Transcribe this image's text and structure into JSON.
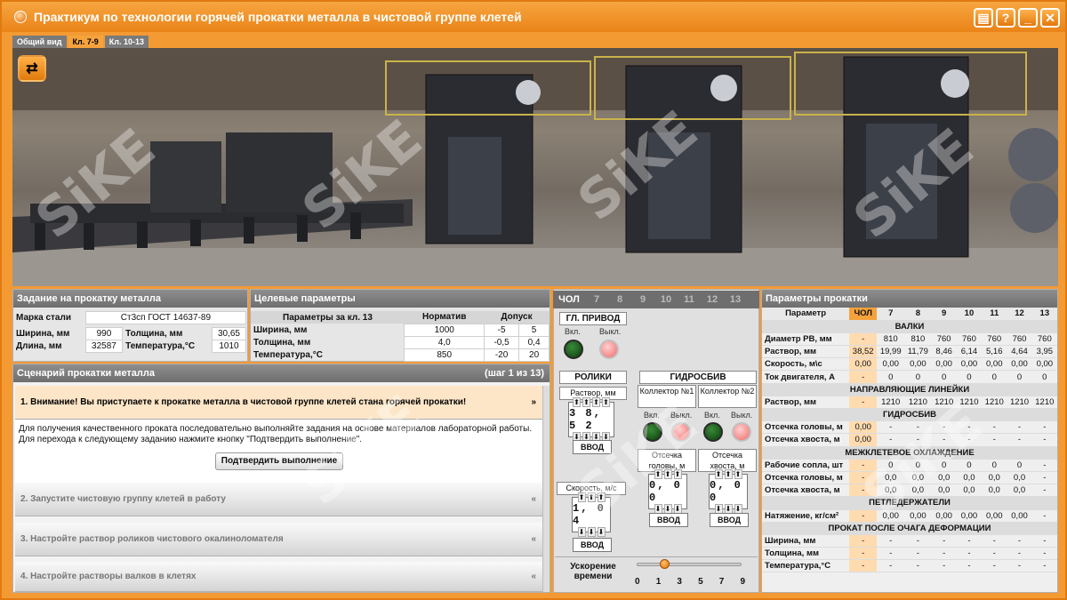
{
  "title": "Практикум по технологии горячей прокатки металла в чистовой группе клетей",
  "window_buttons": {
    "notes": "▤",
    "help": "?",
    "minimize": "_",
    "close": "✕"
  },
  "view_tabs": [
    "Общий вид",
    "Кл. 7-9",
    "Кл. 10-13"
  ],
  "active_view_tab": 1,
  "watermark": "SiKE",
  "task": {
    "header": "Задание на прокатку металла",
    "steel_label": "Марка стали",
    "steel_value": "Ст3сп ГОСТ 14637-89",
    "width_label": "Ширина, мм",
    "width_value": "990",
    "thickness_label": "Толщина, мм",
    "thickness_value": "30,65",
    "length_label": "Длина, мм",
    "length_value": "32587",
    "temp_label": "Температура,°С",
    "temp_value": "1010"
  },
  "targets": {
    "header": "Целевые параметры",
    "col_param": "Параметры за кл. 13",
    "col_norm": "Норматив",
    "col_tol": "Допуск",
    "rows": [
      {
        "name": "Ширина, мм",
        "norm": "1000",
        "tol_lo": "-5",
        "tol_hi": "5"
      },
      {
        "name": "Толщина, мм",
        "norm": "4,0",
        "tol_lo": "-0,5",
        "tol_hi": "0,4"
      },
      {
        "name": "Температура,°С",
        "norm": "850",
        "tol_lo": "-20",
        "tol_hi": "20"
      }
    ]
  },
  "scenario": {
    "header": "Сценарий прокатки металла",
    "step": "(шаг 1 из 13)",
    "items": [
      {
        "label": "1.  Внимание! Вы приступаете к прокатке металла в чистовой группе клетей стана горячей прокатки!",
        "chevron": "»"
      },
      {
        "label": "2.  Запустите чистовую группу клетей в работу",
        "chevron": "«"
      },
      {
        "label": "3.  Настройте раствор роликов чистового окалиноломателя",
        "chevron": "«"
      },
      {
        "label": "4.  Настройте растворы валков в клетях",
        "chevron": "«"
      }
    ],
    "body_lines": [
      "Для получения качественного проката последовательно выполняйте задания на основе материалов лабораторной работы.",
      "Для перехода к следующему заданию нажмите кнопку \"Подтвердить выполнение\"."
    ],
    "confirm_label": "Подтвердить выполнение"
  },
  "control": {
    "tabs": [
      "ЧОЛ",
      "7",
      "8",
      "9",
      "10",
      "11",
      "12",
      "13"
    ],
    "main_drive": "ГЛ. ПРИВОД",
    "on": "Вкл.",
    "off": "Выкл.",
    "rollers": "РОЛИКИ",
    "gap_label": "Раствор, мм",
    "gap_value": "3 8, 5 2",
    "speed_label": "Скорость, м/с",
    "speed_value": "1, 0 4",
    "enter": "ВВОД",
    "hydro": "ГИДРОСБИВ",
    "collector1": "Коллектор №1",
    "collector2": "Коллектор №2",
    "cut_head": "Отсечка головы, м",
    "cut_tail": "Отсечка хвоста, м",
    "cut_head_value": "0, 0 0",
    "cut_tail_value": "0, 0 0",
    "accel_label": "Ускорение времени",
    "accel_ticks": [
      "0",
      "1",
      "3",
      "5",
      "7",
      "9"
    ],
    "accel_value": 0.23
  },
  "params": {
    "header": "Параметры прокатки",
    "head": [
      "Параметр",
      "ЧОЛ",
      "7",
      "8",
      "9",
      "10",
      "11",
      "12",
      "13"
    ],
    "sections": [
      {
        "title": "ВАЛКИ",
        "rows": [
          {
            "name": "Диаметр РВ, мм",
            "v": [
              "-",
              "810",
              "810",
              "760",
              "760",
              "760",
              "760",
              "760"
            ]
          },
          {
            "name": "Раствор, мм",
            "v": [
              "38,52",
              "19,99",
              "11,79",
              "8,46",
              "6,14",
              "5,16",
              "4,64",
              "3,95"
            ]
          },
          {
            "name": "Скорость, м\\с",
            "v": [
              "0,00",
              "0,00",
              "0,00",
              "0,00",
              "0,00",
              "0,00",
              "0,00",
              "0,00"
            ]
          },
          {
            "name": "Ток двигателя, А",
            "v": [
              "-",
              "0",
              "0",
              "0",
              "0",
              "0",
              "0",
              "0"
            ]
          }
        ]
      },
      {
        "title": "НАПРАВЛЯЮЩИЕ ЛИНЕЙКИ",
        "rows": [
          {
            "name": "Раствор, мм",
            "v": [
              "-",
              "1210",
              "1210",
              "1210",
              "1210",
              "1210",
              "1210",
              "1210"
            ]
          }
        ]
      },
      {
        "title": "ГИДРОСБИВ",
        "rows": [
          {
            "name": "Отсечка головы, м",
            "v": [
              "0,00",
              "-",
              "-",
              "-",
              "-",
              "-",
              "-",
              "-"
            ]
          },
          {
            "name": "Отсечка хвоста, м",
            "v": [
              "0,00",
              "-",
              "-",
              "-",
              "-",
              "-",
              "-",
              "-"
            ]
          }
        ]
      },
      {
        "title": "МЕЖКЛЕТЕВОЕ ОХЛАЖДЕНИЕ",
        "rows": [
          {
            "name": "Рабочие сопла, шт",
            "v": [
              "-",
              "0",
              "0",
              "0",
              "0",
              "0",
              "0",
              "-"
            ]
          },
          {
            "name": "Отсечка головы, м",
            "v": [
              "-",
              "0,0",
              "0,0",
              "0,0",
              "0,0",
              "0,0",
              "0,0",
              "-"
            ]
          },
          {
            "name": "Отсечка хвоста, м",
            "v": [
              "-",
              "0,0",
              "0,0",
              "0,0",
              "0,0",
              "0,0",
              "0,0",
              "-"
            ]
          }
        ]
      },
      {
        "title": "ПЕТЛЕДЕРЖАТЕЛИ",
        "rows": [
          {
            "name": "Натяжение, кг/см²",
            "v": [
              "-",
              "0,00",
              "0,00",
              "0,00",
              "0,00",
              "0,00",
              "0,00",
              "-"
            ]
          }
        ]
      },
      {
        "title": "ПРОКАТ ПОСЛЕ ОЧАГА ДЕФОРМАЦИИ",
        "rows": [
          {
            "name": "Ширина, мм",
            "v": [
              "-",
              "-",
              "-",
              "-",
              "-",
              "-",
              "-",
              "-"
            ]
          },
          {
            "name": "Толщина, мм",
            "v": [
              "-",
              "-",
              "-",
              "-",
              "-",
              "-",
              "-",
              "-"
            ]
          },
          {
            "name": "Температура,°С",
            "v": [
              "-",
              "-",
              "-",
              "-",
              "-",
              "-",
              "-",
              "-"
            ]
          }
        ]
      }
    ]
  }
}
